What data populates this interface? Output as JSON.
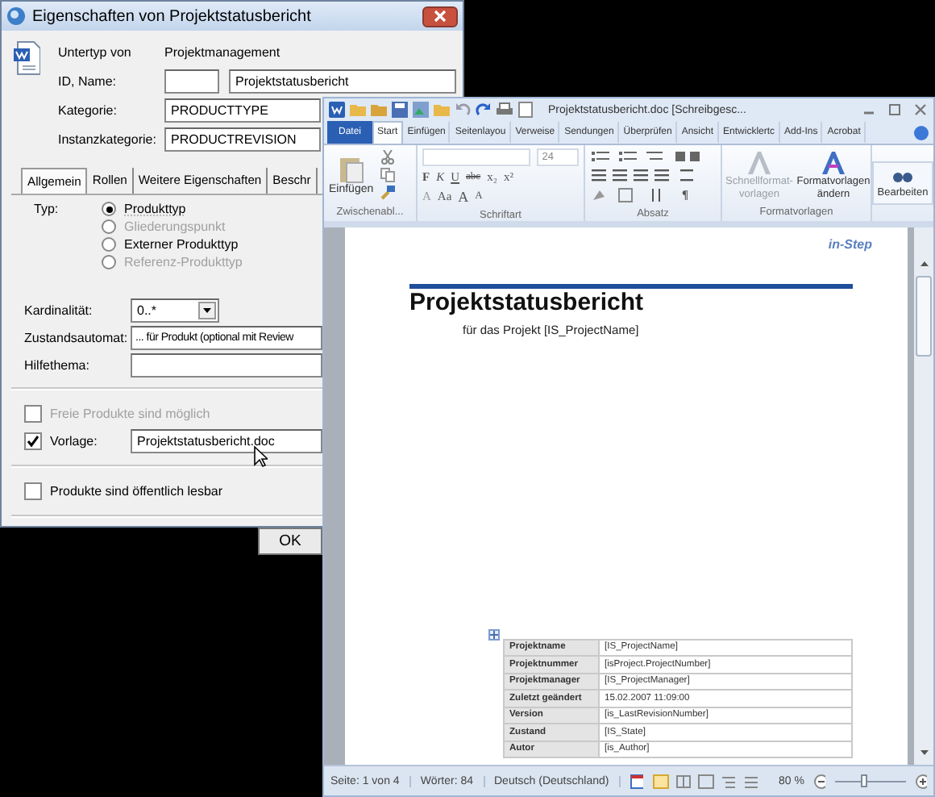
{
  "dialog": {
    "title": "Eigenschaften von Projektstatusbericht",
    "subtype_label": "Untertyp von",
    "subtype_value": "Projektmanagement",
    "id_label": "ID, Name:",
    "name_value": "Projektstatusbericht",
    "fields": [
      {
        "label": "Kategorie:",
        "value": "PRODUCTTYPE"
      },
      {
        "label": "Instanzkategorie:",
        "value": "PRODUCTREVISION"
      }
    ],
    "tabs": [
      {
        "label": "Allgemein",
        "selected": true
      },
      {
        "label": "Rollen",
        "selected": false
      },
      {
        "label": "Weitere Eigenschaften",
        "selected": false
      },
      {
        "label": "Beschr",
        "selected": false
      }
    ],
    "type_label": "Typ:",
    "type_options": [
      {
        "label": "Produkttyp",
        "selected": true,
        "disabled": false
      },
      {
        "label": "Gliederungspunkt",
        "selected": false,
        "disabled": true
      },
      {
        "label": "Externer Produkttyp",
        "selected": false,
        "disabled": false
      },
      {
        "label": "Referenz-Produkttyp",
        "selected": false,
        "disabled": true
      }
    ],
    "settings": [
      {
        "kind": "combo",
        "label": "Kardinalität:",
        "value": "0..*"
      },
      {
        "kind": "field",
        "label": "Zustandsautomat:",
        "value": "... für Produkt (optional mit Review"
      },
      {
        "kind": "field",
        "label": "Hilfethema:"
      }
    ],
    "checks": [
      {
        "label": "Freie Produkte sind möglich",
        "checked": false,
        "disabled": true
      },
      {
        "label": "Vorlage:",
        "checked": true,
        "disabled": false,
        "value": "Projektstatusbericht.doc"
      },
      {
        "label": "Produkte sind öffentlich lesbar",
        "checked": false,
        "disabled": false
      }
    ],
    "buttons": [
      "OK"
    ]
  },
  "word": {
    "title": "Projektstatusbericht.doc [Schreibgesc...",
    "tabs": [
      {
        "label": "Datei",
        "kind": "file",
        "selected": false
      },
      {
        "label": "Start",
        "kind": "tab",
        "selected": true
      },
      {
        "label": "Einfügen",
        "kind": "tab",
        "selected": false
      },
      {
        "label": "Seitenlayou",
        "kind": "tab",
        "selected": false
      },
      {
        "label": "Verweise",
        "kind": "tab",
        "selected": false
      },
      {
        "label": "Sendungen",
        "kind": "tab",
        "selected": false
      },
      {
        "label": "Überprüfen",
        "kind": "tab",
        "selected": false
      },
      {
        "label": "Ansicht",
        "kind": "tab",
        "selected": false
      },
      {
        "label": "Entwicklertc",
        "kind": "tab",
        "selected": false
      },
      {
        "label": "Add-Ins",
        "kind": "tab",
        "selected": false
      },
      {
        "label": "Acrobat",
        "kind": "tab",
        "selected": false
      }
    ],
    "ribbon": {
      "clipboard": {
        "button": "Einfügen",
        "label": "Zwischenabl..."
      },
      "font": {
        "size": "24",
        "buttons": [
          "F",
          "K",
          "U",
          "abc",
          "x₂",
          "x²"
        ],
        "buttons2": [
          "A",
          "Aa",
          "A",
          "A"
        ],
        "label": "Schriftart"
      },
      "paragraph": {
        "button": "¶",
        "label": "Absatz"
      },
      "styles": {
        "buttons": [
          {
            "label": "Schnellformat-vorlagen",
            "disabled": true
          },
          {
            "label": "Formatvorlagen ändern",
            "disabled": false
          }
        ],
        "label": "Formatvorlagen"
      },
      "editing": {
        "button": "Bearbeiten"
      }
    },
    "document": {
      "logo": "in-Step",
      "heading": "Projektstatusbericht",
      "subtitle": "für das Projekt [IS_ProjectName]",
      "table": [
        [
          "Projektname",
          "[IS_ProjectName]"
        ],
        [
          "Projektnummer",
          "[isProject.ProjectNumber]"
        ],
        [
          "Projektmanager",
          "[IS_ProjectManager]"
        ],
        [
          "Zuletzt geändert",
          "15.02.2007 11:09:00"
        ],
        [
          "Version",
          "[is_LastRevisionNumber]"
        ],
        [
          "Zustand",
          "[IS_State]"
        ],
        [
          "Autor",
          "[is_Author]"
        ]
      ]
    },
    "status_bar": {
      "items": [
        "Seite: 1 von 4",
        "Wörter: 84",
        "Deutsch (Deutschland)"
      ],
      "zoom": "80 %",
      "zoom_slider": {
        "level": 0.4
      }
    }
  }
}
